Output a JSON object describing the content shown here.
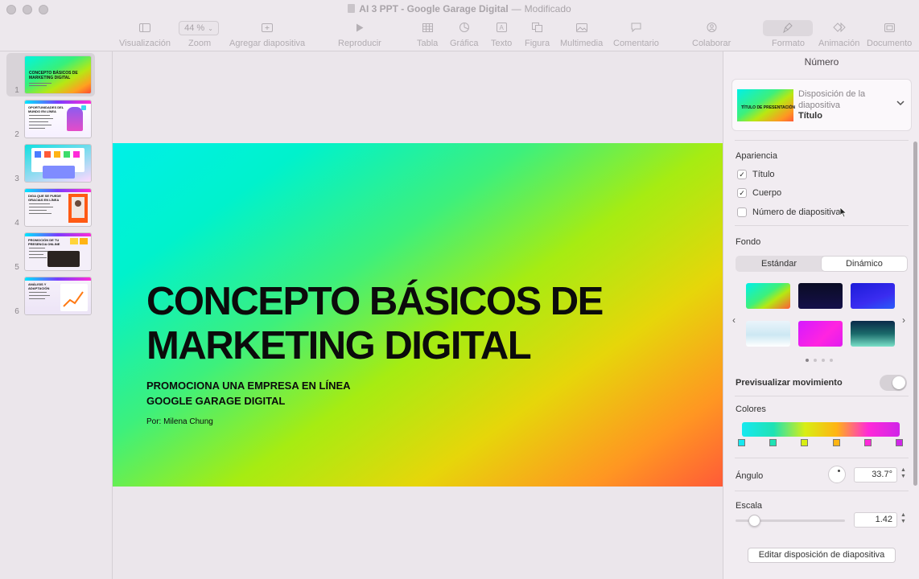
{
  "window": {
    "title": "AI 3 PPT - Google Garage Digital",
    "separator": "—",
    "status": "Modificado"
  },
  "toolbar": {
    "zoom_value": "44 %",
    "items": {
      "view": "Visualización",
      "zoom": "Zoom",
      "add_slide": "Agregar diapositiva",
      "play": "Reproducir",
      "table": "Tabla",
      "chart": "Gráfica",
      "text": "Texto",
      "shape": "Figura",
      "media": "Multimedia",
      "comment": "Comentario",
      "collaborate": "Colaborar",
      "format": "Formato",
      "animate": "Animación",
      "document": "Documento"
    }
  },
  "sidebar": {
    "slides": [
      {
        "number": "1"
      },
      {
        "number": "2"
      },
      {
        "number": "3"
      },
      {
        "number": "4"
      },
      {
        "number": "5"
      },
      {
        "number": "6"
      }
    ],
    "thumb_titles": {
      "s1": "CONCEPTO BÁSICOS DE\nMARKETING DIGITAL",
      "s2": "OPORTUNIDADES DEL\nMUNDO EN LÍNEA",
      "s4": "DIGA QUE SE PUEDE\nGRACIAS EN LÍNEA",
      "s5": "PROMOCIÓN DE TU\nPRESENCIA ONLINE",
      "s6": "ANÁLISIS Y\nADAPTACIÓN"
    }
  },
  "slide": {
    "title": "CONCEPTO BÁSICOS DE\nMARKETING DIGITAL",
    "subtitle": "PROMOCIONA UNA EMPRESA EN LÍNEA\nGOOGLE GARAGE DIGITAL",
    "author": "Por:  Milena Chung"
  },
  "inspector": {
    "header": "Número",
    "layout": {
      "label": "Disposición de la diapositiva",
      "value": "Título",
      "thumb_text": "TÍTULO DE PRESENTACIÓN"
    },
    "appearance": {
      "label": "Apariencia",
      "options": [
        {
          "label": "Título",
          "checked": true
        },
        {
          "label": "Cuerpo",
          "checked": true
        },
        {
          "label": "Número de diapositiva",
          "checked": false
        }
      ]
    },
    "background": {
      "label": "Fondo",
      "tabs": [
        "Estándar",
        "Dinámico"
      ],
      "active_tab": "Dinámico"
    },
    "preview_motion": {
      "label": "Previsualizar movimiento",
      "on": true
    },
    "colors": {
      "label": "Colores",
      "stops": [
        "#17e8f0",
        "#1fe2b4",
        "#d8ee14",
        "#ffb414",
        "#ff2ad8",
        "#d026e8"
      ]
    },
    "angle": {
      "label": "Ángulo",
      "value": "33.7°"
    },
    "scale": {
      "label": "Escala",
      "value": "1.42",
      "position": 0.12
    },
    "edit_button": "Editar disposición de diapositiva"
  }
}
